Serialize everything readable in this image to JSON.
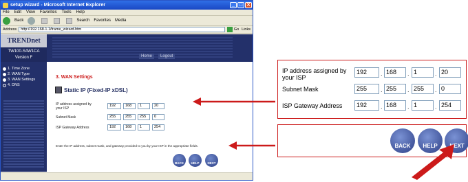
{
  "window": {
    "title": "setup wizard - Microsoft Internet Explorer",
    "minimize": "_",
    "maximize": "□",
    "close": "✕"
  },
  "menu": [
    "File",
    "Edit",
    "View",
    "Favorites",
    "Tools",
    "Help"
  ],
  "toolbar": {
    "back": "Back",
    "search": "Search",
    "favorites": "Favorites",
    "media": "Media"
  },
  "address": {
    "label": "Address",
    "url": "http://192.168.1.1/frame_wizard.htm",
    "go": "Go",
    "links": "Links"
  },
  "brand": {
    "logo": "TRENDnet",
    "model": "TW100-S4W1CA",
    "version": "Version F"
  },
  "banner_nav": {
    "home": "Home",
    "logout": "Logout"
  },
  "steps": [
    {
      "label": "1. Time Zone",
      "done": true
    },
    {
      "label": "2. WAN Type",
      "done": true
    },
    {
      "label": "3. WAN Settings",
      "done": true
    },
    {
      "label": "4. DNS",
      "done": false
    }
  ],
  "page": {
    "heading": "3. WAN Settings",
    "subtitle": "Static IP (Fixed-IP xDSL)",
    "fields": [
      {
        "label": "IP address assigned by your ISP",
        "octets": [
          "192",
          "168",
          "1",
          "20"
        ]
      },
      {
        "label": "Subnet Mask",
        "octets": [
          "255",
          "255",
          "255",
          "0"
        ]
      },
      {
        "label": "ISP Gateway Address",
        "octets": [
          "192",
          "168",
          "1",
          "254"
        ]
      }
    ],
    "help_text": "Enter the IP address, subnet mask, and gateway provided to you by your ISP in the appropriate fields."
  },
  "buttons": {
    "back": "BACK",
    "help": "HELP",
    "next": "NEXT"
  },
  "colors": {
    "navy": "#23306a",
    "accent_red": "#cc1a1a",
    "heading_red": "#cc1a1a"
  }
}
